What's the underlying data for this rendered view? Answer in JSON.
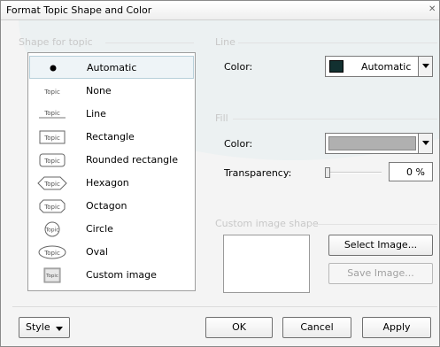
{
  "dialog": {
    "title": "Format Topic Shape and Color",
    "close_icon": "close-icon"
  },
  "shape_group": {
    "label": "Shape for topic",
    "items": [
      {
        "label": "Automatic",
        "icon": "dot-shape-icon",
        "selected": true
      },
      {
        "label": "None",
        "icon": "none-shape-icon",
        "selected": false,
        "sample": "Topic"
      },
      {
        "label": "Line",
        "icon": "line-shape-icon",
        "selected": false,
        "sample": "Topic"
      },
      {
        "label": "Rectangle",
        "icon": "rectangle-shape-icon",
        "selected": false,
        "sample": "Topic"
      },
      {
        "label": "Rounded rectangle",
        "icon": "rounded-rectangle-shape-icon",
        "selected": false,
        "sample": "Topic"
      },
      {
        "label": "Hexagon",
        "icon": "hexagon-shape-icon",
        "selected": false,
        "sample": "Topic"
      },
      {
        "label": "Octagon",
        "icon": "octagon-shape-icon",
        "selected": false,
        "sample": "Topic"
      },
      {
        "label": "Circle",
        "icon": "circle-shape-icon",
        "selected": false,
        "sample": "Topic"
      },
      {
        "label": "Oval",
        "icon": "oval-shape-icon",
        "selected": false,
        "sample": "Topic"
      },
      {
        "label": "Custom image",
        "icon": "custom-image-shape-icon",
        "selected": false,
        "sample": "Topic"
      }
    ]
  },
  "line_group": {
    "label": "Line",
    "color_label": "Color:",
    "color_value": "Automatic",
    "color_swatch": "#123030"
  },
  "fill_group": {
    "label": "Fill",
    "color_label": "Color:",
    "color_swatch": "#b0b0b0",
    "transparency_label": "Transparency:",
    "transparency_value": "0 %",
    "transparency_level": 0
  },
  "custom_image_group": {
    "label": "Custom image shape",
    "select_button": "Select Image...",
    "save_button": "Save Image..."
  },
  "footer": {
    "style_button": "Style",
    "ok_button": "OK",
    "cancel_button": "Cancel",
    "apply_button": "Apply"
  }
}
